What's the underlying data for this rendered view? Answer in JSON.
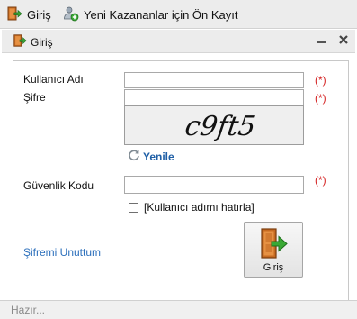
{
  "toolbar": {
    "login_label": "Giriş",
    "register_label": "Yeni Kazananlar için Ön Kayıt"
  },
  "window": {
    "title": "Giriş",
    "minimize_symbol": "—",
    "close_symbol": "✖"
  },
  "form": {
    "username": {
      "label": "Kullanıcı Adı",
      "value": "",
      "required_marker": "(*)"
    },
    "password": {
      "label": "Şifre",
      "value": "",
      "required_marker": "(*)"
    },
    "captcha": {
      "image_text": "c9ft5",
      "required_marker": "(*)"
    },
    "refresh_label": "Yenile",
    "security_code": {
      "label": "Güvenlik Kodu",
      "value": ""
    },
    "remember_label": "[Kullanıcı adımı hatırla]",
    "remember_checked": false,
    "forgot_password_label": "Şifremi Unuttum",
    "submit_label": "Giriş"
  },
  "status": {
    "text": "Hazır..."
  },
  "icons": {
    "login": "door-arrow-icon",
    "register": "user-add-icon",
    "refresh": "refresh-icon"
  },
  "colors": {
    "required": "#d42020",
    "link": "#2a6ebb",
    "accent_green": "#3aa935",
    "door_orange": "#d2772a"
  }
}
